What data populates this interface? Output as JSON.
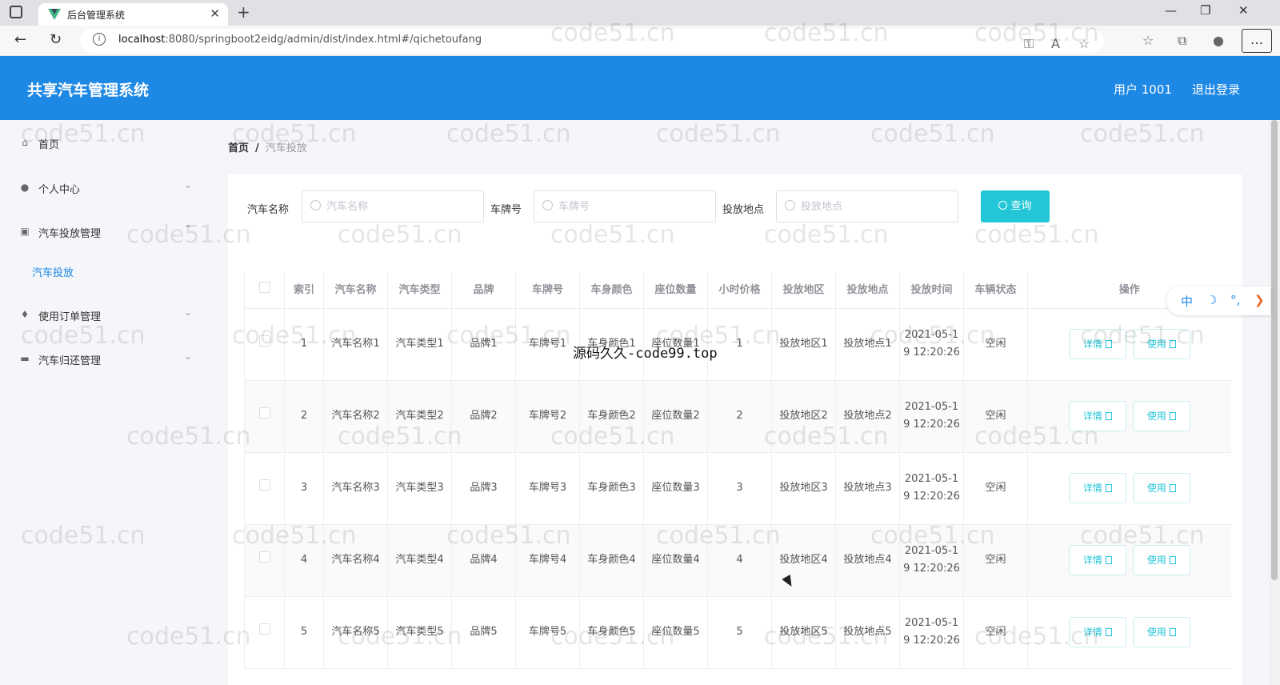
{
  "browser": {
    "tab_title": "后台管理系统",
    "url_host": "localhost",
    "url_rest": ":8080/springboot2eidg/admin/dist/index.html#/qichetoufang"
  },
  "header": {
    "app_title": "共享汽车管理系统",
    "user_label": "用户 1001",
    "logout_label": "退出登录"
  },
  "sidebar": {
    "items": [
      {
        "label": "首页",
        "icon": "home-icon"
      },
      {
        "label": "个人中心",
        "icon": "user-icon"
      },
      {
        "label": "汽车投放管理",
        "icon": "clipboard-icon"
      },
      {
        "label": "使用订单管理",
        "icon": "mic-icon"
      },
      {
        "label": "汽车归还管理",
        "icon": "flag-icon"
      }
    ],
    "sub_item": "汽车投放"
  },
  "breadcrumb": {
    "home": "首页",
    "sep": "/",
    "current": "汽车投放"
  },
  "search": {
    "name_label": "汽车名称",
    "name_placeholder": "汽车名称",
    "plate_label": "车牌号",
    "plate_placeholder": "车牌号",
    "location_label": "投放地点",
    "location_placeholder": "投放地点",
    "query_label": "查询"
  },
  "table": {
    "headers": [
      "索引",
      "汽车名称",
      "汽车类型",
      "品牌",
      "车牌号",
      "车身颜色",
      "座位数量",
      "小时价格",
      "投放地区",
      "投放地点",
      "投放时间",
      "车辆状态",
      "操作"
    ],
    "detail_label": "详情",
    "use_label": "使用",
    "rows": [
      {
        "index": "1",
        "name": "汽车名称1",
        "type": "汽车类型1",
        "brand": "品牌1",
        "plate": "车牌号1",
        "color": "车身颜色1",
        "seats": "座位数量1",
        "price": "1",
        "region": "投放地区1",
        "location": "投放地点1",
        "time": "2021-05-19 12:20:26",
        "status": "空闲"
      },
      {
        "index": "2",
        "name": "汽车名称2",
        "type": "汽车类型2",
        "brand": "品牌2",
        "plate": "车牌号2",
        "color": "车身颜色2",
        "seats": "座位数量2",
        "price": "2",
        "region": "投放地区2",
        "location": "投放地点2",
        "time": "2021-05-19 12:20:26",
        "status": "空闲"
      },
      {
        "index": "3",
        "name": "汽车名称3",
        "type": "汽车类型3",
        "brand": "品牌3",
        "plate": "车牌号3",
        "color": "车身颜色3",
        "seats": "座位数量3",
        "price": "3",
        "region": "投放地区3",
        "location": "投放地点3",
        "time": "2021-05-19 12:20:26",
        "status": "空闲"
      },
      {
        "index": "4",
        "name": "汽车名称4",
        "type": "汽车类型4",
        "brand": "品牌4",
        "plate": "车牌号4",
        "color": "车身颜色4",
        "seats": "座位数量4",
        "price": "4",
        "region": "投放地区4",
        "location": "投放地点4",
        "time": "2021-05-19 12:20:26",
        "status": "空闲"
      },
      {
        "index": "5",
        "name": "汽车名称5",
        "type": "汽车类型5",
        "brand": "品牌5",
        "plate": "车牌号5",
        "color": "车身颜色5",
        "seats": "座位数量5",
        "price": "5",
        "region": "投放地区5",
        "location": "投放地点5",
        "time": "2021-05-19 12:20:26",
        "status": "空闲"
      }
    ]
  },
  "float_toolbar": {
    "lang": "中",
    "moon": "☽",
    "dots": "°,",
    "arrow": "❯"
  },
  "overlay_text": "源码久久-code99.top",
  "watermark_text": "code51.cn",
  "colors": {
    "accent": "#1e88e5",
    "button": "#23c6d6",
    "sidebar_bg": "#f4f6f9"
  }
}
